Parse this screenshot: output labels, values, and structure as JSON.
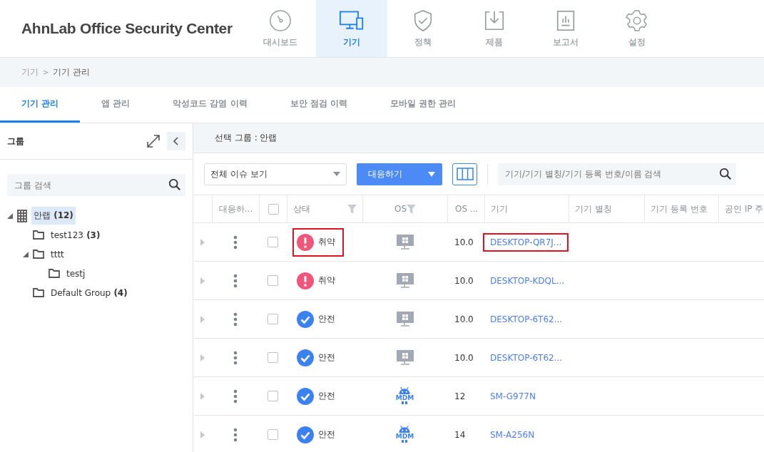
{
  "brand": "AhnLab Office Security Center",
  "nav": [
    {
      "label": "대시보드",
      "selected": false
    },
    {
      "label": "기기",
      "selected": true
    },
    {
      "label": "정책",
      "selected": false
    },
    {
      "label": "제품",
      "selected": false
    },
    {
      "label": "보고서",
      "selected": false
    },
    {
      "label": "설정",
      "selected": false
    }
  ],
  "breadcrumb": {
    "parent": "기기",
    "separator": ">",
    "current": "기기 관리"
  },
  "tabs": [
    {
      "label": "기기 관리",
      "selected": true
    },
    {
      "label": "앱 관리",
      "selected": false
    },
    {
      "label": "악성코드 감염 이력",
      "selected": false
    },
    {
      "label": "보안 점검 이력",
      "selected": false
    },
    {
      "label": "모바일 권한 관리",
      "selected": false
    }
  ],
  "sidebar": {
    "title": "그룹",
    "search": {
      "placeholder": "그룹 검색"
    },
    "tree": [
      {
        "name": "안랩",
        "count": "(12)",
        "kind": "company",
        "selected": true,
        "expanded": true,
        "children": [
          {
            "name": "test123",
            "count": "(3)",
            "kind": "folder",
            "selected": false
          },
          {
            "name": "tttt",
            "kind": "folder",
            "selected": false,
            "expanded": true,
            "children": [
              {
                "name": "testj",
                "kind": "folder",
                "selected": false
              }
            ]
          },
          {
            "name": "Default Group",
            "count": "(4)",
            "kind": "folder",
            "selected": false
          }
        ]
      }
    ]
  },
  "selected_group": {
    "label": "선택 그룹 : 안랩"
  },
  "toolbar": {
    "filter": "전체 이슈 보기",
    "action_button": "대응하기",
    "search": {
      "placeholder": "기기/기기 별칭/기기 등록 번호/이름 검색"
    }
  },
  "table": {
    "columns": [
      {
        "label": "대응하..."
      },
      {
        "kind": "checkbox",
        "checked": false
      },
      {
        "label": "상태",
        "filter": true
      },
      {
        "label": "OS",
        "filter": true
      },
      {
        "label": "OS ..."
      },
      {
        "label": "기기"
      },
      {
        "label": "기기 별칭"
      },
      {
        "label": "기기 등록 번호"
      },
      {
        "label": "공인 IP 주"
      }
    ],
    "rows": [
      {
        "checked": false,
        "status": {
          "text": "취약",
          "kind": "vulnerable",
          "marked": true
        },
        "os": {
          "kind": "windows"
        },
        "os_version": "10.0",
        "device": {
          "text": "DESKTOP-QR7J...",
          "marked": true
        }
      },
      {
        "checked": false,
        "status": {
          "text": "취약",
          "kind": "vulnerable",
          "marked": false
        },
        "os": {
          "kind": "windows"
        },
        "os_version": "10.0",
        "device": {
          "text": "DESKTOP-KDQL...",
          "marked": false
        }
      },
      {
        "checked": false,
        "status": {
          "text": "안전",
          "kind": "safe",
          "marked": false
        },
        "os": {
          "kind": "windows"
        },
        "os_version": "10.0",
        "device": {
          "text": "DESKTOP-6T62...",
          "marked": false
        }
      },
      {
        "checked": false,
        "status": {
          "text": "안전",
          "kind": "safe",
          "marked": false
        },
        "os": {
          "kind": "windows"
        },
        "os_version": "10.0",
        "device": {
          "text": "DESKTOP-6T62...",
          "marked": false
        }
      },
      {
        "checked": false,
        "status": {
          "text": "안전",
          "kind": "safe",
          "marked": false
        },
        "os": {
          "kind": "android",
          "badge": "MDM"
        },
        "os_version": "12",
        "device": {
          "text": "SM-G977N",
          "marked": false
        }
      },
      {
        "checked": false,
        "status": {
          "text": "안전",
          "kind": "safe",
          "marked": false
        },
        "os": {
          "kind": "android",
          "badge": "MDM"
        },
        "os_version": "14",
        "device": {
          "text": "SM-A256N",
          "marked": false
        }
      }
    ]
  }
}
